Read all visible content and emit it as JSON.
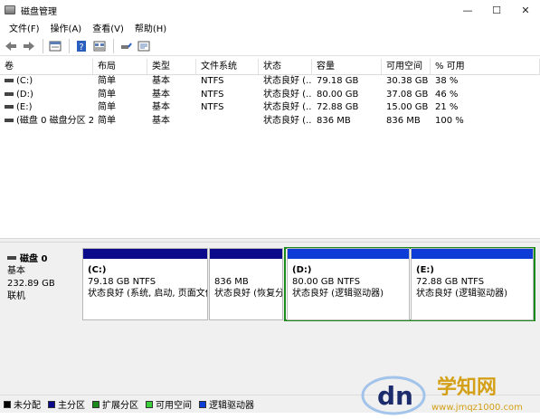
{
  "window": {
    "title": "磁盘管理",
    "minimize": "—",
    "maximize": "☐",
    "close": "✕"
  },
  "menu": [
    "文件(F)",
    "操作(A)",
    "查看(V)",
    "帮助(H)"
  ],
  "toolbar": {
    "icons": [
      "back-arrow-icon",
      "forward-arrow-icon",
      "properties-icon",
      "help-icon",
      "view-icon",
      "disk-connect-icon",
      "console-icon"
    ]
  },
  "list": {
    "columns": [
      "卷",
      "布局",
      "类型",
      "文件系统",
      "状态",
      "容量",
      "可用空间",
      "% 可用"
    ],
    "rows": [
      [
        "(C:)",
        "简单",
        "基本",
        "NTFS",
        "状态良好 (...",
        "79.18 GB",
        "30.38 GB",
        "38 %"
      ],
      [
        "(D:)",
        "简单",
        "基本",
        "NTFS",
        "状态良好 (...",
        "80.00 GB",
        "37.08 GB",
        "46 %"
      ],
      [
        "(E:)",
        "简单",
        "基本",
        "NTFS",
        "状态良好 (...",
        "72.88 GB",
        "15.00 GB",
        "21 %"
      ],
      [
        "(磁盘 0 磁盘分区 2)",
        "简单",
        "基本",
        "",
        "状态良好 (...",
        "836 MB",
        "836 MB",
        "100 %"
      ]
    ]
  },
  "disk": {
    "name": "磁盘 0",
    "type": "基本",
    "size": "232.89 GB",
    "status": "联机"
  },
  "partitions": [
    {
      "name": "(C:)",
      "size": "79.18 GB NTFS",
      "status": "状态良好 (系统, 启动, 页面文件"
    },
    {
      "name": "",
      "size": "836 MB",
      "status": "状态良好 (恢复分"
    },
    {
      "name": "(D:)",
      "size": "80.00 GB NTFS",
      "status": "状态良好 (逻辑驱动器)"
    },
    {
      "name": "(E:)",
      "size": "72.88 GB NTFS",
      "status": "状态良好 (逻辑驱动器)"
    }
  ],
  "legend": [
    {
      "label": "未分配",
      "color": "#000000"
    },
    {
      "label": "主分区",
      "color": "#0a0a8a"
    },
    {
      "label": "扩展分区",
      "color": "#1a8a1a"
    },
    {
      "label": "可用空间",
      "color": "#3ccf3c"
    },
    {
      "label": "逻辑驱动器",
      "color": "#0e3cd6"
    }
  ],
  "watermark": {
    "logo": "dn",
    "text": "学知网",
    "url": "www.jmqz1000.com"
  }
}
